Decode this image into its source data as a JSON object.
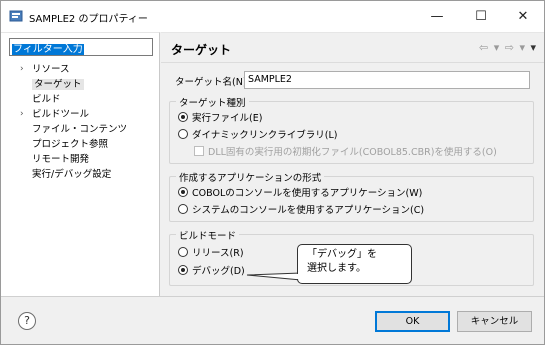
{
  "window": {
    "title": "SAMPLE2 のプロパティー",
    "minimize_glyph": "—",
    "maximize_glyph": "☐",
    "close_glyph": "✕"
  },
  "sidebar": {
    "filter_value": "フィルター入力",
    "items": [
      {
        "label": "リソース",
        "expandable": true
      },
      {
        "label": "ターゲット",
        "selected": true
      },
      {
        "label": "ビルド"
      },
      {
        "label": "ビルドツール",
        "expandable": true
      },
      {
        "label": "ファイル・コンテンツ"
      },
      {
        "label": "プロジェクト参照"
      },
      {
        "label": "リモート開発"
      },
      {
        "label": "実行/デバッグ設定"
      }
    ]
  },
  "main": {
    "title": "ターゲット",
    "target_name_label": "ターゲット名(N):",
    "target_name_value": "SAMPLE2",
    "target_type": {
      "title": "ターゲット種別",
      "options": [
        "実行ファイル(E)",
        "ダイナミックリンクライブラリ(L)"
      ],
      "dll_checkbox": "DLL固有の実行用の初期化ファイル(COBOL85.CBR)を使用する(O)"
    },
    "app_format": {
      "title": "作成するアプリケーションの形式",
      "options": [
        "COBOLのコンソールを使用するアプリケーション(W)",
        "システムのコンソールを使用するアプリケーション(C)"
      ]
    },
    "build_mode": {
      "title": "ビルドモード",
      "options": [
        "リリース(R)",
        "デバッグ(D)"
      ]
    }
  },
  "callout": {
    "line1": "「デバッグ」を",
    "line2": "選択します。"
  },
  "buttons": {
    "help": "?",
    "ok": "OK",
    "cancel": "キャンセル"
  },
  "nav": {
    "back": "⇦",
    "forward": "⇨",
    "dropdown": "▾",
    "menu": "▾"
  }
}
